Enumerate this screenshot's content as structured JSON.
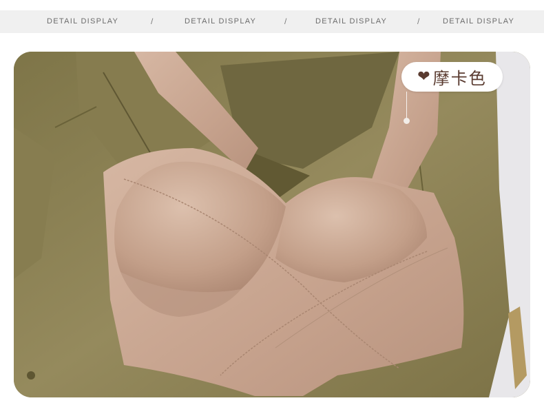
{
  "header": {
    "tabs": [
      {
        "label": "DETAIL DISPLAY"
      },
      {
        "label": "DETAIL DISPLAY"
      },
      {
        "label": "DETAIL DISPLAY"
      },
      {
        "label": "DETAIL DISPLAY"
      }
    ],
    "separator": "/"
  },
  "photo": {
    "color_tag": {
      "icon": "heart-icon",
      "label": "摩卡色"
    }
  },
  "colors": {
    "jacket": "#8f8558",
    "product": "#c9a793",
    "tag_text": "#5a3b30",
    "header_bg": "#f0f0f0"
  }
}
